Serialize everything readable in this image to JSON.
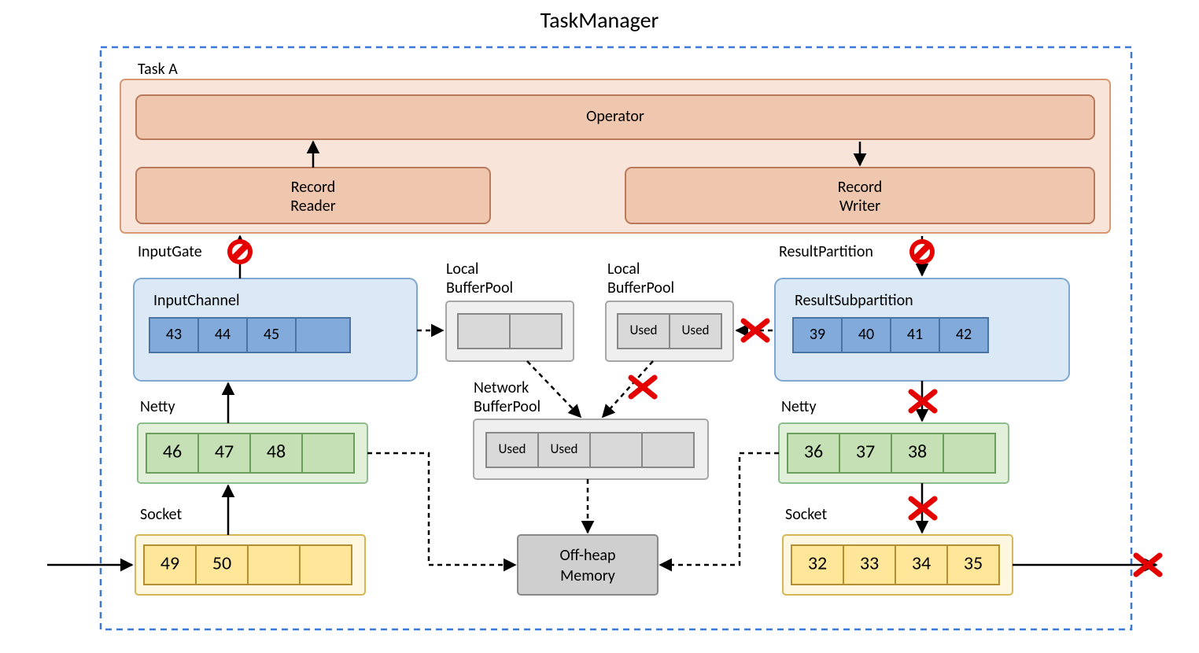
{
  "title": "TaskManager",
  "taskA": {
    "label": "Task A",
    "operator": "Operator",
    "recordReader": "Record Reader",
    "recordWriter": "Record Writer"
  },
  "inputGate": {
    "label": "InputGate",
    "channel": "InputChannel",
    "cells": [
      "43",
      "44",
      "45",
      ""
    ]
  },
  "resultPartition": {
    "label": "ResultPartition",
    "sub": "ResultSubpartition",
    "cells": [
      "39",
      "40",
      "41",
      "42"
    ]
  },
  "localBP1": {
    "label1": "Local",
    "label2": "BufferPool",
    "cells": [
      "",
      ""
    ]
  },
  "localBP2": {
    "label1": "Local",
    "label2": "BufferPool",
    "cells": [
      "Used",
      "Used"
    ]
  },
  "networkBP": {
    "label1": "Network",
    "label2": "BufferPool",
    "cells": [
      "Used",
      "Used",
      "",
      ""
    ]
  },
  "offheap": "Off-heap Memory",
  "nettyLeft": {
    "label": "Netty",
    "cells": [
      "46",
      "47",
      "48",
      ""
    ]
  },
  "nettyRight": {
    "label": "Netty",
    "cells": [
      "36",
      "37",
      "38",
      ""
    ]
  },
  "socketLeft": {
    "label": "Socket",
    "cells": [
      "49",
      "50",
      "",
      ""
    ]
  },
  "socketRight": {
    "label": "Socket",
    "cells": [
      "32",
      "33",
      "34",
      "35"
    ]
  }
}
